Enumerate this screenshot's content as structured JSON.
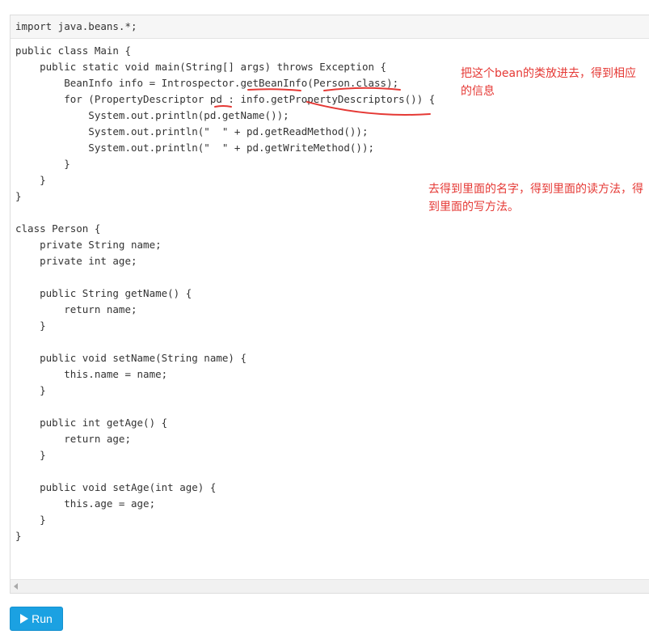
{
  "editor": {
    "import_line": "import java.beans.*;",
    "code_lines": [
      "public class Main {",
      "    public static void main(String[] args) throws Exception {",
      "        BeanInfo info = Introspector.getBeanInfo(Person.class);",
      "        for (PropertyDescriptor pd : info.getPropertyDescriptors()) {",
      "            System.out.println(pd.getName());",
      "            System.out.println(\"  \" + pd.getReadMethod());",
      "            System.out.println(\"  \" + pd.getWriteMethod());",
      "        }",
      "    }",
      "}",
      "",
      "class Person {",
      "    private String name;",
      "    private int age;",
      "",
      "    public String getName() {",
      "        return name;",
      "    }",
      "",
      "    public void setName(String name) {",
      "        this.name = name;",
      "    }",
      "",
      "    public int getAge() {",
      "        return age;",
      "    }",
      "",
      "    public void setAge(int age) {",
      "        this.age = age;",
      "    }",
      "}"
    ]
  },
  "annotations": {
    "note1": "把这个bean的类放进去，得到相应的信息",
    "note2": "去得到里面的名字，得到里面的读方法，得到里面的写方法。",
    "color": "#e53935"
  },
  "run_button": {
    "label": "Run",
    "icon": "play-icon",
    "color": "#1ba1e2"
  }
}
